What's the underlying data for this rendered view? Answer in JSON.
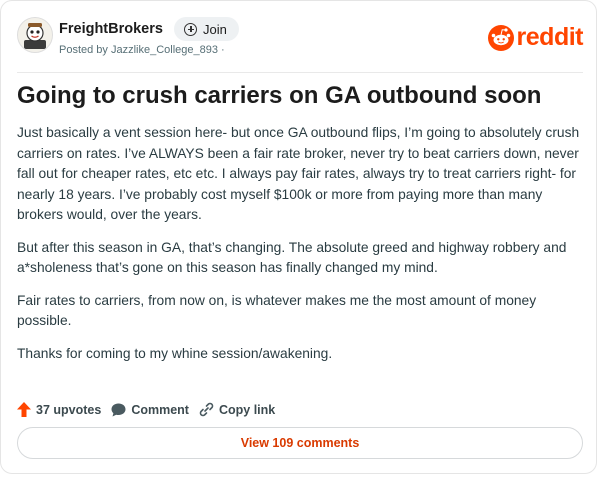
{
  "post": {
    "subreddit": "FreightBrokers",
    "join_label": "Join",
    "posted_by": "Posted by Jazzlike_College_893 ·",
    "brand": "reddit",
    "title": "Going to crush carriers on GA outbound soon",
    "paragraphs": [
      "Just basically a vent session here- but once GA outbound flips, I’m going to absolutely crush carriers on rates. I’ve ALWAYS been a fair rate broker, never try to beat carriers down, never fall out for cheaper rates, etc etc. I always pay fair rates, always try to treat carriers right- for nearly 18 years. I’ve probably cost myself $100k or more from paying more than many brokers would, over the years.",
      "But after this season in GA, that’s changing. The absolute greed and highway robbery and a*sholeness that’s gone on this season has finally changed my mind.",
      "Fair rates to carriers, from now on, is whatever makes me the most amount of money possible.",
      "Thanks for coming to my whine session/awakening."
    ],
    "actions": {
      "upvotes": "37 upvotes",
      "comment": "Comment",
      "copy_link": "Copy link"
    },
    "view_comments": "View 109 comments"
  },
  "colors": {
    "brand": "#ff4500",
    "view_comments_text": "#d93a00"
  },
  "icons": [
    "subreddit-avatar-icon",
    "plus-circle-icon",
    "reddit-snoo-icon",
    "upvote-arrow-icon",
    "comment-bubble-icon",
    "link-icon"
  ]
}
